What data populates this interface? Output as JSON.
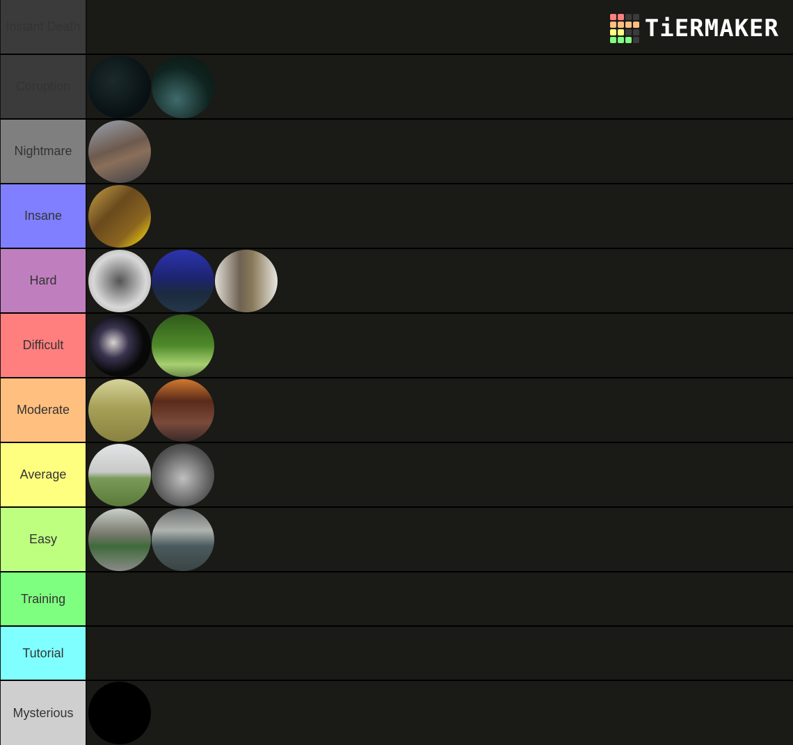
{
  "logo": {
    "text": "TiERMAKER",
    "grid_colors": [
      "#ff7f7f",
      "#ff7f7f",
      "#3b3b3b",
      "#3b3b3b",
      "#ffbf7f",
      "#ffbf7f",
      "#ffbf7f",
      "#ffbf7f",
      "#ffff7f",
      "#ffff7f",
      "#3b3b3b",
      "#3b3b3b",
      "#7fff7f",
      "#7fff7f",
      "#7fff7f",
      "#3b3b3b"
    ]
  },
  "tiers": [
    {
      "label": "Instant Death",
      "color": "#3b3b3b",
      "items": []
    },
    {
      "label": "Coruption",
      "color": "#3b3b3b",
      "items": [
        {
          "name": "dark-foliage-night",
          "bg": "radial-gradient(circle at 40% 40%, #1c2a2c, #071012 70%)"
        },
        {
          "name": "night-street-lamps",
          "bg": "radial-gradient(circle at 40% 70%, #3f6b6b, #0f2420 55%, #0b140f)"
        }
      ]
    },
    {
      "label": "Nightmare",
      "color": "#7f7f7f",
      "items": [
        {
          "name": "flooded-room-piano",
          "bg": "linear-gradient(160deg, #9aa3b0, #6d5a4e 45%, #8a6f5a 60%, #3c4048)"
        }
      ]
    },
    {
      "label": "Insane",
      "color": "#7f7fff",
      "items": [
        {
          "name": "golden-sewer-arch",
          "bg": "linear-gradient(135deg, #c9a24a, #6a4a1d 40%, #8a6420 70%, #e0c010 90%)"
        }
      ]
    },
    {
      "label": "Hard",
      "color": "#bf7fbf",
      "items": [
        {
          "name": "white-tunnel",
          "bg": "radial-gradient(circle at 50% 50%, #555, #d8d8d8 60%, #999)"
        },
        {
          "name": "castle-ruins-night",
          "bg": "linear-gradient(180deg, #2c34b0, #1d2470 45%, #1c2a3e 70%, #24384a)"
        },
        {
          "name": "jail-corridor",
          "bg": "linear-gradient(90deg, #e0ddd5, #6e6252 40%, #8a7a5a 60%, #e8e6e0)"
        }
      ]
    },
    {
      "label": "Difficult",
      "color": "#ff7f7f",
      "items": [
        {
          "name": "blurry-dark-figure",
          "bg": "radial-gradient(circle at 40% 45%, #d8d4d0, #3a3450 30%, #080808 60%)"
        },
        {
          "name": "jungle-path",
          "bg": "linear-gradient(180deg, #2f5a1a, #4f8a2a 50%, #a8d070 80%, #6a8a4a)"
        }
      ]
    },
    {
      "label": "Moderate",
      "color": "#ffbf7f",
      "items": [
        {
          "name": "yellow-backrooms",
          "bg": "linear-gradient(180deg, #d6d49a, #a6a058 45%, #8a8240)"
        },
        {
          "name": "ornate-lobby",
          "bg": "linear-gradient(180deg, #d07a30, #5a2a1a 35%, #7a4a3a 70%, #3a2a2a)"
        }
      ]
    },
    {
      "label": "Average",
      "color": "#ffff7f",
      "items": [
        {
          "name": "foggy-field",
          "bg": "linear-gradient(180deg, #e2e4e6, #c8cac8 45%, #7a9a5a 55%, #5a7a3a)"
        },
        {
          "name": "empty-parking-garage",
          "bg": "radial-gradient(circle at 50% 55%, #c0c0c0, #5a5a5a 60%, #2a2a2a)"
        }
      ]
    },
    {
      "label": "Easy",
      "color": "#bfff7f",
      "items": [
        {
          "name": "empty-city-street",
          "bg": "linear-gradient(180deg, #c8d0c8, #7a7a70 40%, #3f6a3a 60%, #8a8a88)"
        },
        {
          "name": "empty-office-floor",
          "bg": "linear-gradient(180deg, #6a6e6e, #b0b4b0 35%, #4a5a5c 60%, #3a4444)"
        }
      ]
    },
    {
      "label": "Training",
      "color": "#7fff7f",
      "items": []
    },
    {
      "label": "Tutorial",
      "color": "#7fffff",
      "items": []
    },
    {
      "label": "Mysterious",
      "color": "#cfcfcf",
      "items": [
        {
          "name": "black-void",
          "bg": "#000000"
        }
      ]
    }
  ]
}
